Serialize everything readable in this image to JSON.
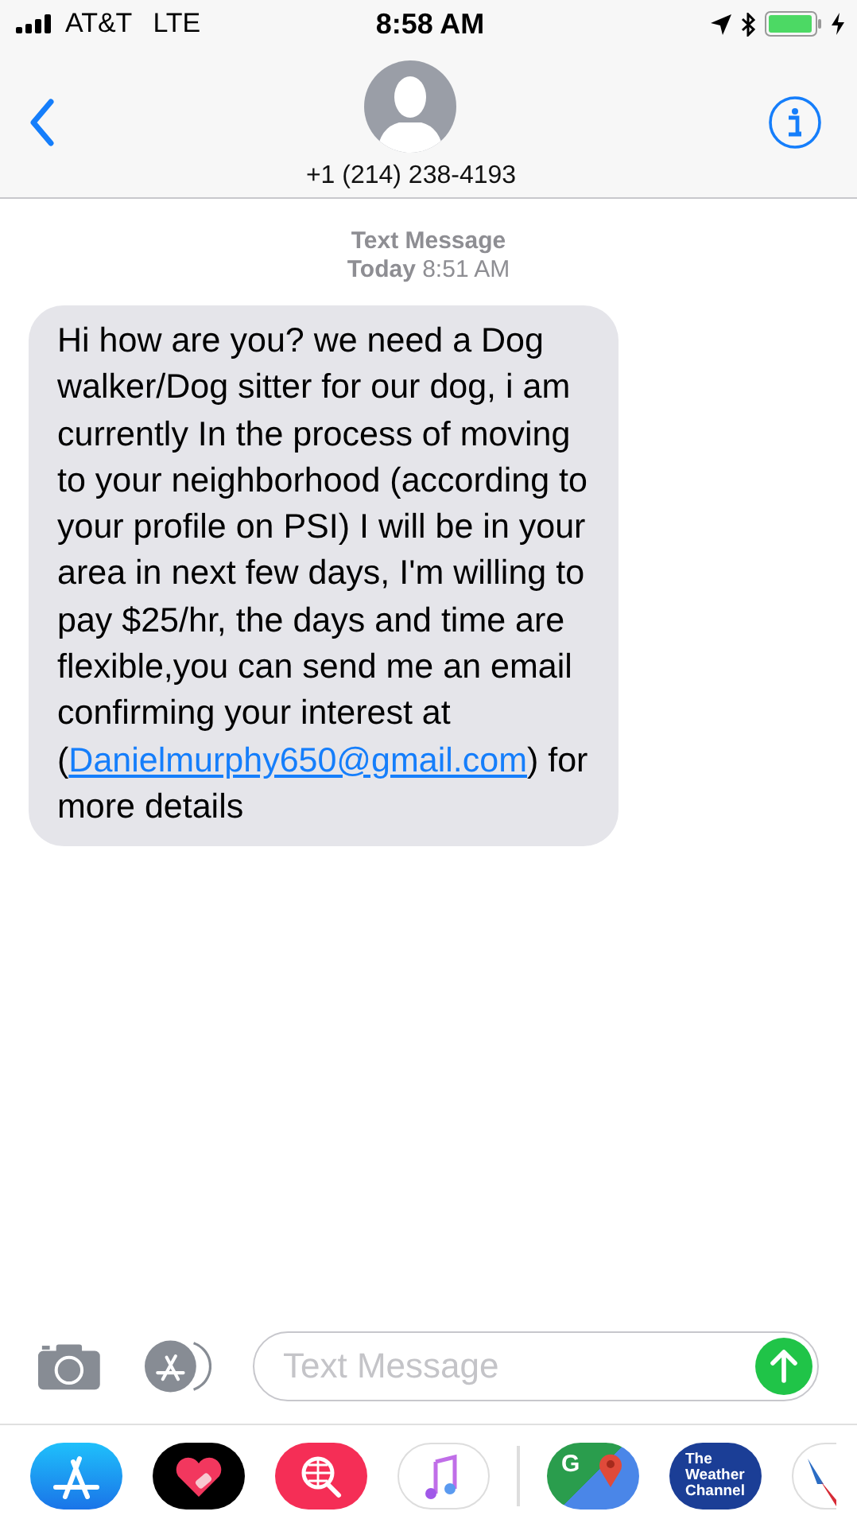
{
  "status_bar": {
    "carrier": "AT&T",
    "network": "LTE",
    "time": "8:58 AM"
  },
  "header": {
    "contact": "+1 (214) 238-4193"
  },
  "conversation": {
    "service": "Text Message",
    "day": "Today",
    "time": "8:51 AM",
    "messages": [
      {
        "kind": "received",
        "text_before": "Hi how are you? we need a Dog walker/Dog sitter for our dog, i am currently In the process of moving to your neighborhood (according to your profile on PSI) I will be in your area in next few days, I'm willing to pay $25/hr, the days and time are flexible,you can send me an email confirming your interest at (",
        "link": "Danielmurphy650@gmail.com",
        "text_after": ") for more details"
      }
    ]
  },
  "composer": {
    "placeholder": "Text Message"
  },
  "app_drawer": [
    {
      "kind": "app-store"
    },
    {
      "kind": "heart"
    },
    {
      "kind": "search"
    },
    {
      "kind": "music"
    },
    {
      "kind": "maps",
      "label": "G"
    },
    {
      "kind": "weather",
      "label": "The Weather Channel"
    },
    {
      "kind": "airline"
    }
  ]
}
